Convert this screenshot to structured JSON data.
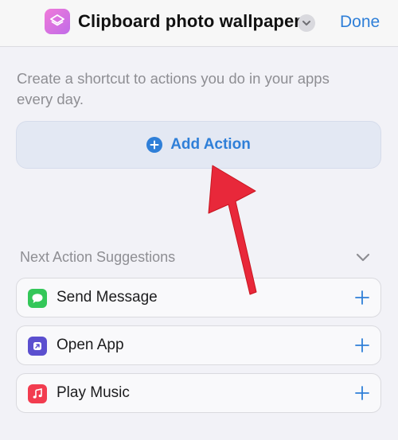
{
  "header": {
    "title": "Clipboard photo wallpaper",
    "done_label": "Done",
    "app_icon": "shortcuts-layers-icon",
    "menu_icon": "chevron-down-icon"
  },
  "description": "Create a shortcut to actions you do in your apps every day.",
  "add_action": {
    "label": "Add Action",
    "icon": "plus-circle-icon"
  },
  "suggestions": {
    "title": "Next Action Suggestions",
    "items": [
      {
        "label": "Send Message",
        "icon": "messages-icon",
        "icon_color": "#34c759"
      },
      {
        "label": "Open App",
        "icon": "open-app-icon",
        "icon_color": "#5b4fcf"
      },
      {
        "label": "Play Music",
        "icon": "music-icon",
        "icon_color": "#f23c4f"
      }
    ]
  },
  "colors": {
    "accent": "#2f7fd8",
    "annotation_arrow": "#e8283a"
  }
}
